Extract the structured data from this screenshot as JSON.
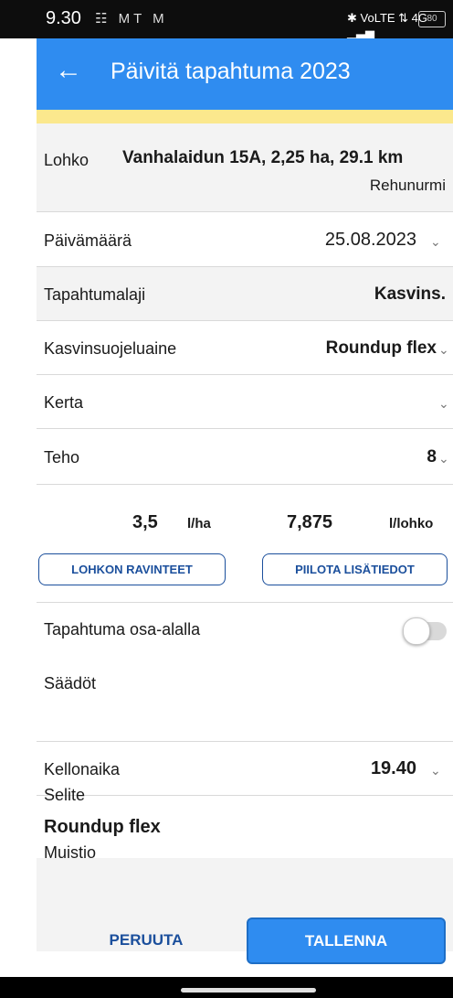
{
  "status_bar": {
    "time": "9.30",
    "left_icons": "☷ MT M",
    "right_icons": "✱ VoLTE ⇅ 4G ▁▃▅",
    "battery": "80"
  },
  "app_bar": {
    "back_icon": "←",
    "title": "Päivitä tapahtuma 2023"
  },
  "form": {
    "lohko": {
      "label": "Lohko",
      "value": "Vanhalaidun 15A, 2,25 ha, 29.1 km",
      "subvalue": "Rehunurmi"
    },
    "paivamaara": {
      "label": "Päivämäärä",
      "value": "25.08.2023"
    },
    "tapahtumalaji": {
      "label": "Tapahtumalaji",
      "value": "Kasvins."
    },
    "kasvinsuojeluaine": {
      "label": "Kasvinsuojeluaine",
      "value": "Roundup flex"
    },
    "kerta": {
      "label": "Kerta",
      "value": ""
    },
    "teho": {
      "label": "Teho",
      "value": "8"
    },
    "dosage": {
      "per_ha_value": "3,5",
      "per_ha_unit": "l/ha",
      "per_lohko_value": "7,875",
      "per_lohko_unit": "l/lohko"
    },
    "buttons": {
      "nutrients": "LOHKON RAVINTEET",
      "hide_details": "PIILOTA LISÄTIEDOT"
    },
    "osa_alalla": {
      "label": "Tapahtuma osa-alalla",
      "enabled": false
    },
    "saadot": {
      "label": "Säädöt"
    },
    "kellonaika": {
      "label": "Kellonaika",
      "value": "19.40"
    },
    "selite": {
      "label": "Selite",
      "value": "Roundup flex"
    },
    "muistio": {
      "label": "Muistio"
    }
  },
  "actions": {
    "cancel": "PERUUTA",
    "save": "TALLENNA"
  },
  "colors": {
    "accent": "#2f8cf0",
    "button_text": "#1b4f9c",
    "banner": "#fbe88d"
  }
}
